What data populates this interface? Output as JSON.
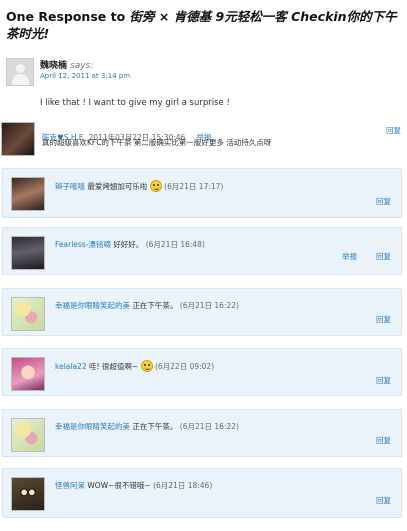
{
  "heading": {
    "prefix": "One Response to ",
    "post_title": "街旁 × 肯德基 9元轻松一客 Checkin你的下午茶时光!"
  },
  "main_comment": {
    "author": "魏晓楠",
    "says": "says:",
    "date": "April 12, 2011 at 3:14 pm",
    "text": "I like that ! I want to give my girl a surprise !"
  },
  "weibo": {
    "top": {
      "author": "陈克♥S.H.E",
      "time": "2011年03月22日 15:30:46",
      "report_label": "举报",
      "reply_label": "回复",
      "text": "真的超级喜欢KFC的下午茶 第二版确实比第一版好更多 活动持久点呀"
    },
    "replies": [
      {
        "author": "辫子嘻嘻",
        "text": "最爱烤翅加可乐啦",
        "has_emoji": true,
        "time": "(6月21日 17:17)",
        "reply_label": "回复",
        "report_label": ""
      },
      {
        "author": "Fearless-漂铭嘀",
        "text": "好好好。",
        "has_emoji": false,
        "time": "(6月21日 16:48)",
        "reply_label": "回复",
        "report_label": "举报"
      },
      {
        "author": "幸福是你眼睛笑起的美",
        "text": "正在下午茶。",
        "has_emoji": false,
        "time": "(6月21日 16:22)",
        "reply_label": "回复",
        "report_label": ""
      },
      {
        "author": "kelala22",
        "text": "哇! 很超值啊~",
        "has_emoji": true,
        "time": "(6月22日 09:02)",
        "reply_label": "回复",
        "report_label": ""
      },
      {
        "author": "幸福是你眼睛笑起的美",
        "text": "正在下午茶。",
        "has_emoji": false,
        "time": "(6月21日 16:22)",
        "reply_label": "回复",
        "report_label": ""
      },
      {
        "author": "怪兽阿呆",
        "text": "WOW~很不错哦~",
        "has_emoji": false,
        "time": "(6月21日 18:46)",
        "reply_label": "回复",
        "report_label": ""
      }
    ]
  },
  "icons": {
    "default_avatar": "person-silhouette-icon",
    "emoji": "smiley-face-icon"
  },
  "colors": {
    "link": "#2a7ab5",
    "reply_background": "#eaf3fa"
  }
}
